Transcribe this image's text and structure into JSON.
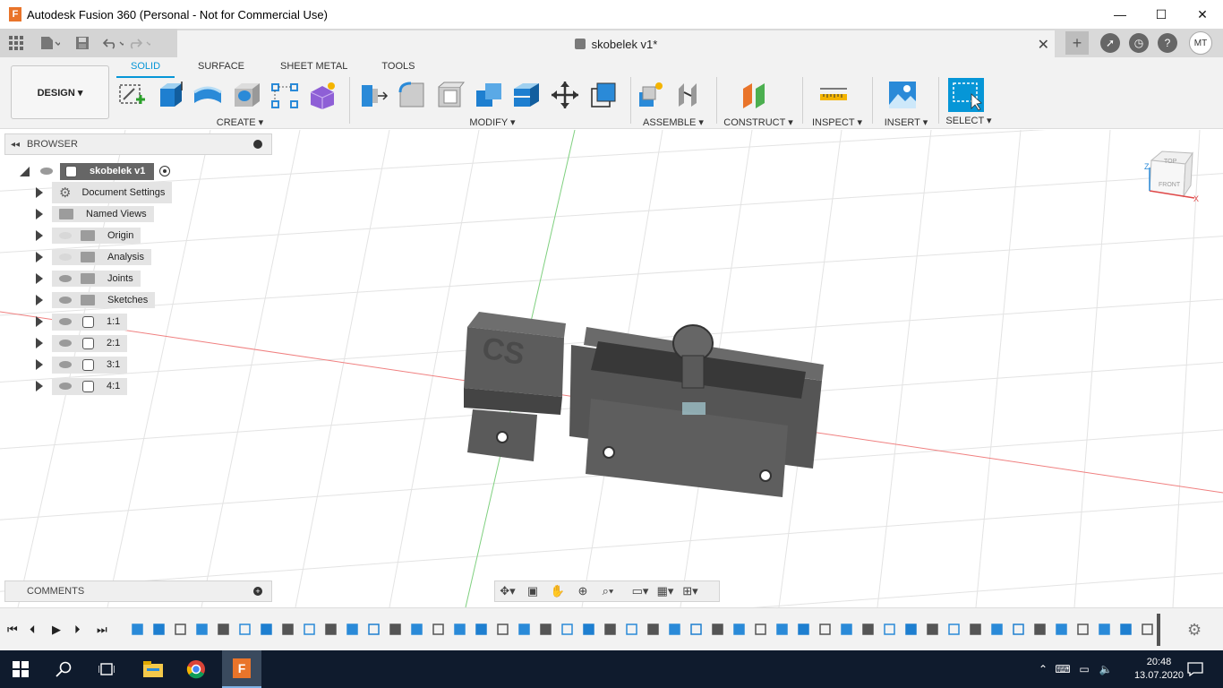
{
  "window": {
    "title": "Autodesk Fusion 360 (Personal - Not for Commercial Use)",
    "app_icon_letter": "F",
    "controls": [
      "—",
      "☐",
      "✕"
    ]
  },
  "quick_access": {
    "document_tab": "skobelek v1*",
    "user_initials": "MT"
  },
  "toolbar": {
    "workspace_label": "DESIGN ▾",
    "tabs": [
      "SOLID",
      "SURFACE",
      "SHEET METAL",
      "TOOLS"
    ],
    "active_tab": "SOLID",
    "groups": {
      "create": "CREATE ▾",
      "modify": "MODIFY ▾",
      "assemble": "ASSEMBLE ▾",
      "construct": "CONSTRUCT ▾",
      "inspect": "INSPECT ▾",
      "insert": "INSERT ▾",
      "select": "SELECT ▾"
    }
  },
  "browser": {
    "title": "BROWSER",
    "root": "skobelek v1",
    "items": [
      {
        "label": "Document Settings",
        "icon": "gear-icon"
      },
      {
        "label": "Named Views",
        "icon": "folder-icon"
      },
      {
        "label": "Origin",
        "icon": "folder-icon",
        "visible": false
      },
      {
        "label": "Analysis",
        "icon": "folder-icon",
        "visible": false
      },
      {
        "label": "Joints",
        "icon": "folder-icon",
        "visible": true
      },
      {
        "label": "Sketches",
        "icon": "folder-icon",
        "visible": true
      },
      {
        "label": "1:1",
        "icon": "component-icon",
        "visible": true
      },
      {
        "label": "2:1",
        "icon": "component-icon",
        "visible": true
      },
      {
        "label": "3:1",
        "icon": "component-icon",
        "visible": true
      },
      {
        "label": "4:1",
        "icon": "component-icon",
        "visible": true
      }
    ]
  },
  "viewcube": {
    "top": "TOP",
    "front": "FRONT",
    "axis_z": "Z",
    "axis_x": "X"
  },
  "comments": {
    "title": "COMMENTS"
  },
  "taskbar": {
    "time": "20:48",
    "date": "13.07.2020"
  },
  "colors": {
    "accent": "#0696d7",
    "taskbar": "#0f1b2d",
    "fusion_orange": "#e9742a"
  }
}
